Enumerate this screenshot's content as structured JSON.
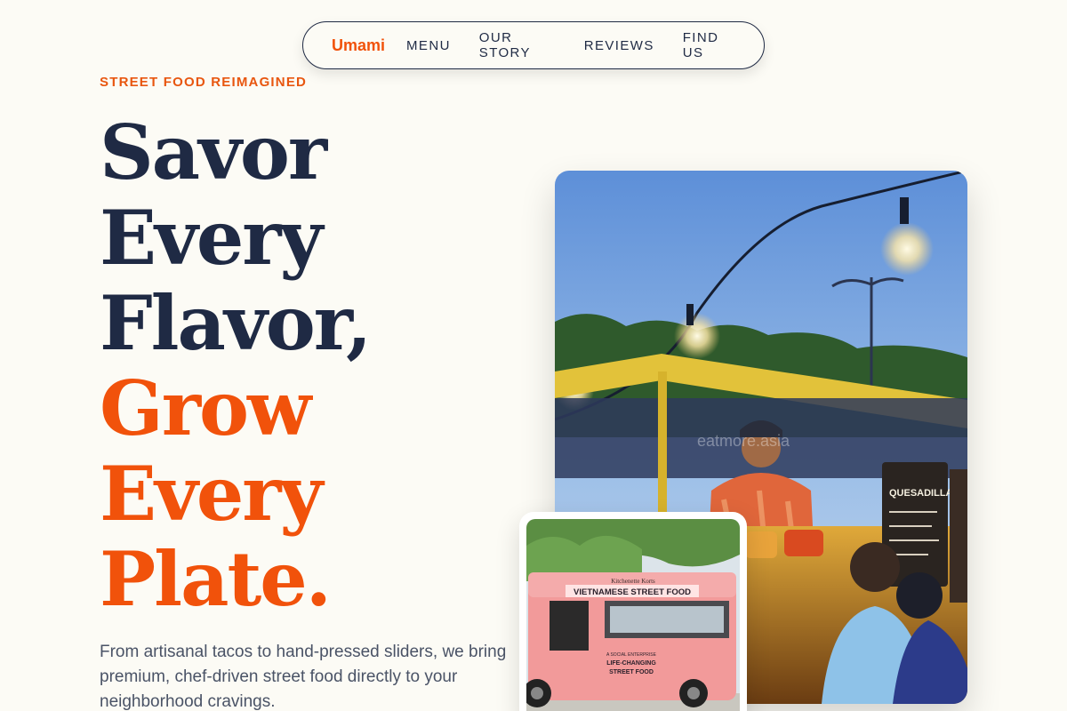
{
  "nav": {
    "brand": "Umami",
    "links": [
      "MENU",
      "OUR STORY",
      "REVIEWS",
      "FIND US"
    ]
  },
  "hero": {
    "eyebrow": "STREET FOOD REIMAGINED",
    "headline_dark": [
      "Savor",
      "Every",
      "Flavor,"
    ],
    "headline_accent": [
      "Grow",
      "Every",
      "Plate."
    ],
    "subcopy": "From artisanal tacos to hand-pressed sliders, we bring premium, chef-driven street food directly to your neighborhood cravings."
  },
  "images": {
    "main": {
      "signs": [
        "QUESADILLA"
      ],
      "watermark": "eatmore.asia"
    },
    "secondary": {
      "truck_header": "VIETNAMESE STREET FOOD",
      "truck_small": "Kitchenette Korts",
      "truck_tagline": [
        "A SOCIAL ENTERPRISE",
        "LIFE-CHANGING",
        "STREET FOOD"
      ]
    }
  },
  "colors": {
    "accent": "#f1520b",
    "ink": "#1f2a44",
    "background": "#fcfbf5",
    "muted_text": "#4a5366"
  }
}
